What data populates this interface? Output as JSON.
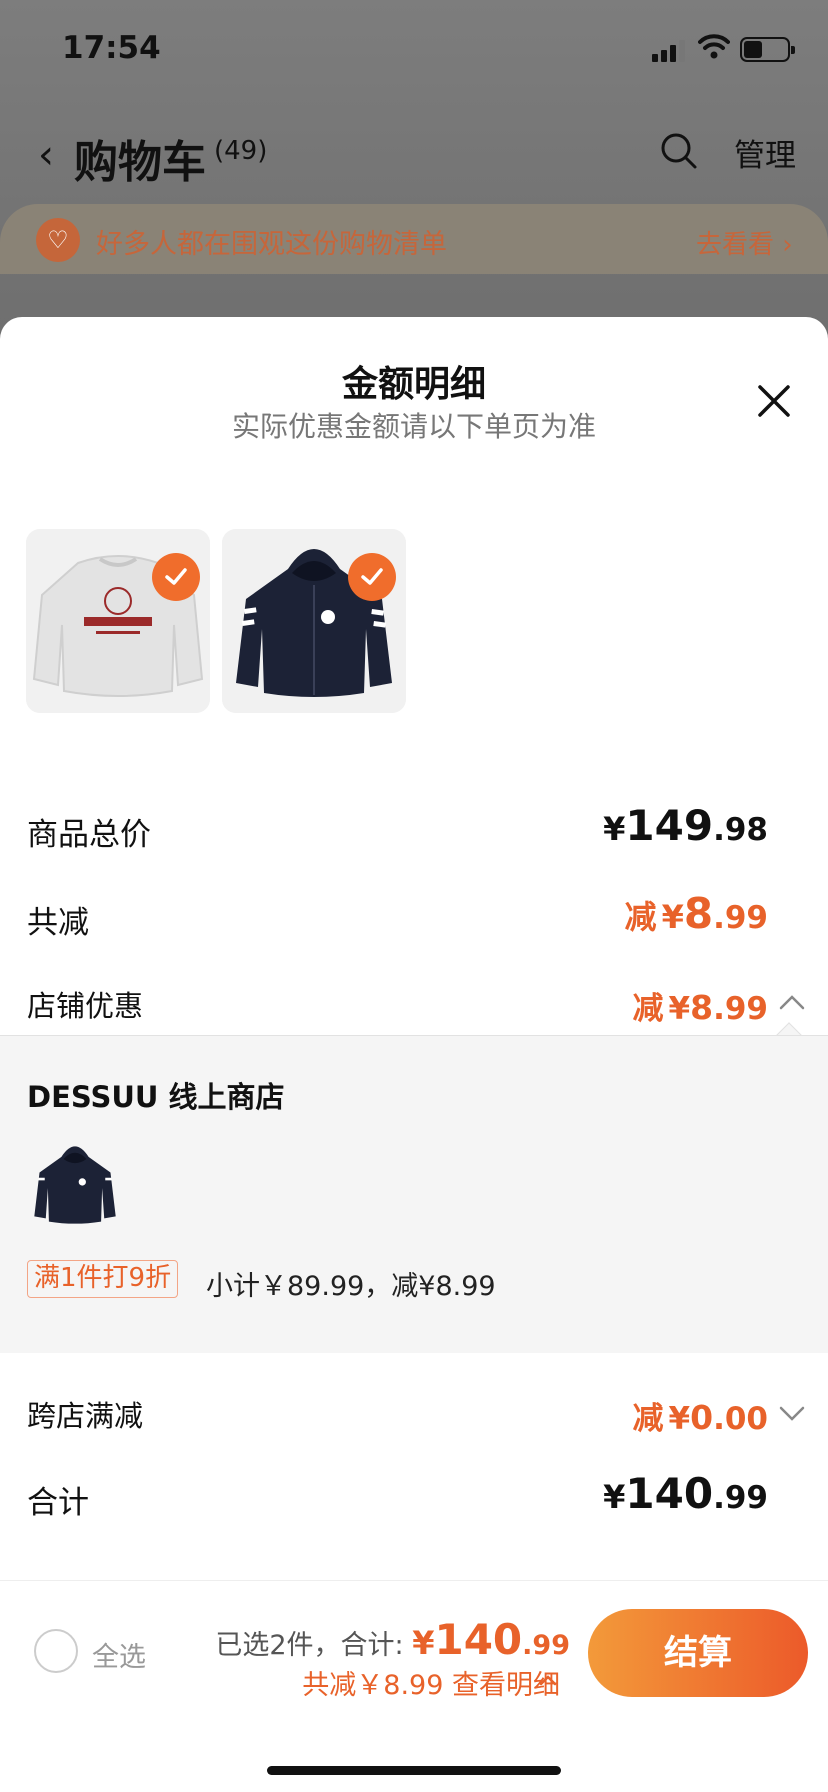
{
  "status_bar": {
    "time": "17:54"
  },
  "header": {
    "back_icon": "chevron-left-icon",
    "title": "购物车",
    "count": "(49)",
    "manage_label": "管理"
  },
  "banner": {
    "text": "好多人都在围观这份购物清单",
    "link": "去看看 ›"
  },
  "sheet": {
    "title": "金额明细",
    "subtitle": "实际优惠金额请以下单页为准",
    "products": [
      {
        "name": "white-sweatshirt",
        "selected": true
      },
      {
        "name": "navy-zip-hoodie",
        "selected": true
      }
    ],
    "total_price": {
      "label": "商品总价",
      "yen": "¥",
      "int": "149",
      "dec": ".98"
    },
    "total_discount": {
      "label": "共减",
      "prefix": "减",
      "yen": "¥",
      "int": "8",
      "dec": ".99"
    },
    "store_discount": {
      "label": "店铺优惠",
      "prefix": "减",
      "yen": "¥",
      "int": "8",
      "dec": ".99"
    },
    "store": {
      "name": "DESSUU 线上商店",
      "promo_tag": "满1件打9折",
      "subtotal": "小计￥89.99，减¥8.99"
    },
    "cross_store": {
      "label": "跨店满减",
      "prefix": "减",
      "yen": "¥",
      "int": "0",
      "dec": ".00"
    },
    "grand_total": {
      "label": "合计",
      "yen": "¥",
      "int": "140",
      "dec": ".99"
    }
  },
  "footer": {
    "select_all": "全选",
    "selected_info": "已选2件，合计: ",
    "yen": "¥",
    "total_int": "140",
    "total_dec": ".99",
    "savings": "共减￥8.99  查看明细",
    "checkout": "结算"
  },
  "colors": {
    "accent": "#e8622a",
    "checkout_start": "#f39a3a",
    "checkout_end": "#ec5a2a"
  }
}
